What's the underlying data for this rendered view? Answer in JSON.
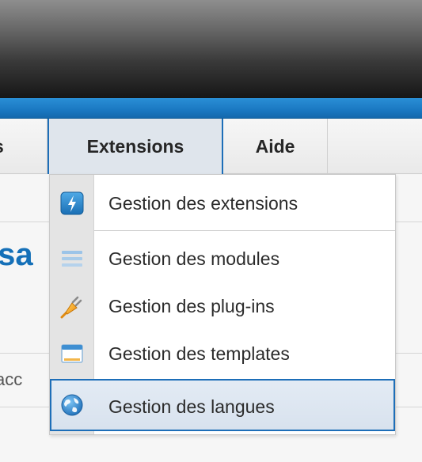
{
  "menubar": {
    "prev_item_label": "s",
    "extensions_label": "Extensions",
    "help_label": "Aide"
  },
  "background": {
    "page_title_fragment": "isa",
    "side_text_fragment": "acc"
  },
  "dropdown": {
    "items": [
      {
        "label": "Gestion des extensions",
        "icon": "extension-manager-icon"
      },
      {
        "label": "Gestion des modules",
        "icon": "module-manager-icon"
      },
      {
        "label": "Gestion des plug-ins",
        "icon": "plugin-manager-icon"
      },
      {
        "label": "Gestion des templates",
        "icon": "template-manager-icon"
      },
      {
        "label": "Gestion des langues",
        "icon": "language-manager-icon",
        "active": true
      }
    ]
  },
  "colors": {
    "accent_blue": "#1d6eb8",
    "header_dark": "#161616",
    "title_blue": "#1570b8"
  }
}
